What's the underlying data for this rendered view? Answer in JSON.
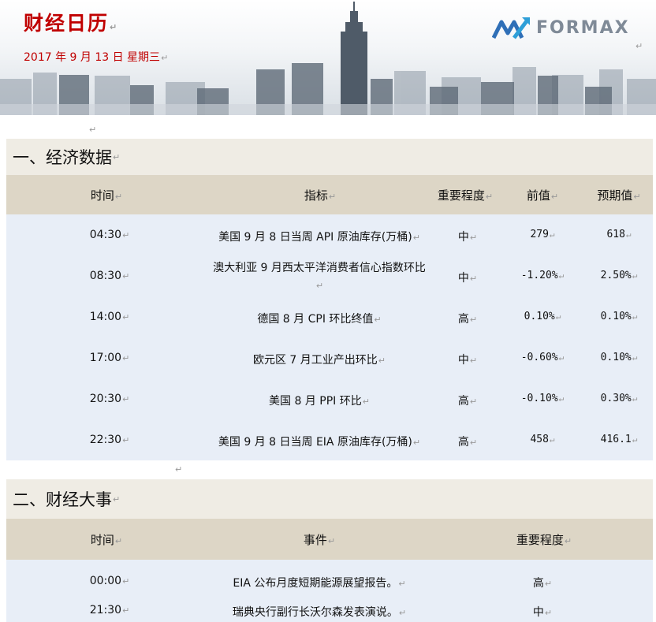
{
  "header": {
    "title": "财经日历",
    "date": "2017 年 9 月 13 日 星期三",
    "logo_text": "FORMAX",
    "para_mark": "↵"
  },
  "economic_data": {
    "section_title": "一、经济数据",
    "columns": [
      "时间",
      "指标",
      "重要程度",
      "前值",
      "预期值"
    ],
    "rows": [
      {
        "time": "04:30",
        "indicator": "美国 9 月 8 日当周 API 原油库存(万桶)",
        "importance": "中",
        "previous": "279",
        "forecast": "618"
      },
      {
        "time": "08:30",
        "indicator": "澳大利亚 9 月西太平洋消费者信心指数环比",
        "importance": "中",
        "previous": "-1.20%",
        "forecast": "2.50%"
      },
      {
        "time": "14:00",
        "indicator": "德国 8 月 CPI 环比终值",
        "importance": "高",
        "previous": "0.10%",
        "forecast": "0.10%"
      },
      {
        "time": "17:00",
        "indicator": "欧元区 7 月工业产出环比",
        "importance": "中",
        "previous": "-0.60%",
        "forecast": "0.10%"
      },
      {
        "time": "20:30",
        "indicator": "美国 8 月 PPI 环比",
        "importance": "高",
        "previous": "-0.10%",
        "forecast": "0.30%"
      },
      {
        "time": "22:30",
        "indicator": "美国 9 月 8 日当周 EIA 原油库存(万桶)",
        "importance": "高",
        "previous": "458",
        "forecast": "416.1"
      }
    ]
  },
  "financial_events": {
    "section_title": "二、财经大事",
    "columns": [
      "时间",
      "事件",
      "重要程度"
    ],
    "rows": [
      {
        "time": "00:00",
        "event": "EIA 公布月度短期能源展望报告。",
        "importance": "高"
      },
      {
        "time": "21:30",
        "event": "瑞典央行副行长沃尔森发表演说。",
        "importance": "中"
      }
    ]
  }
}
